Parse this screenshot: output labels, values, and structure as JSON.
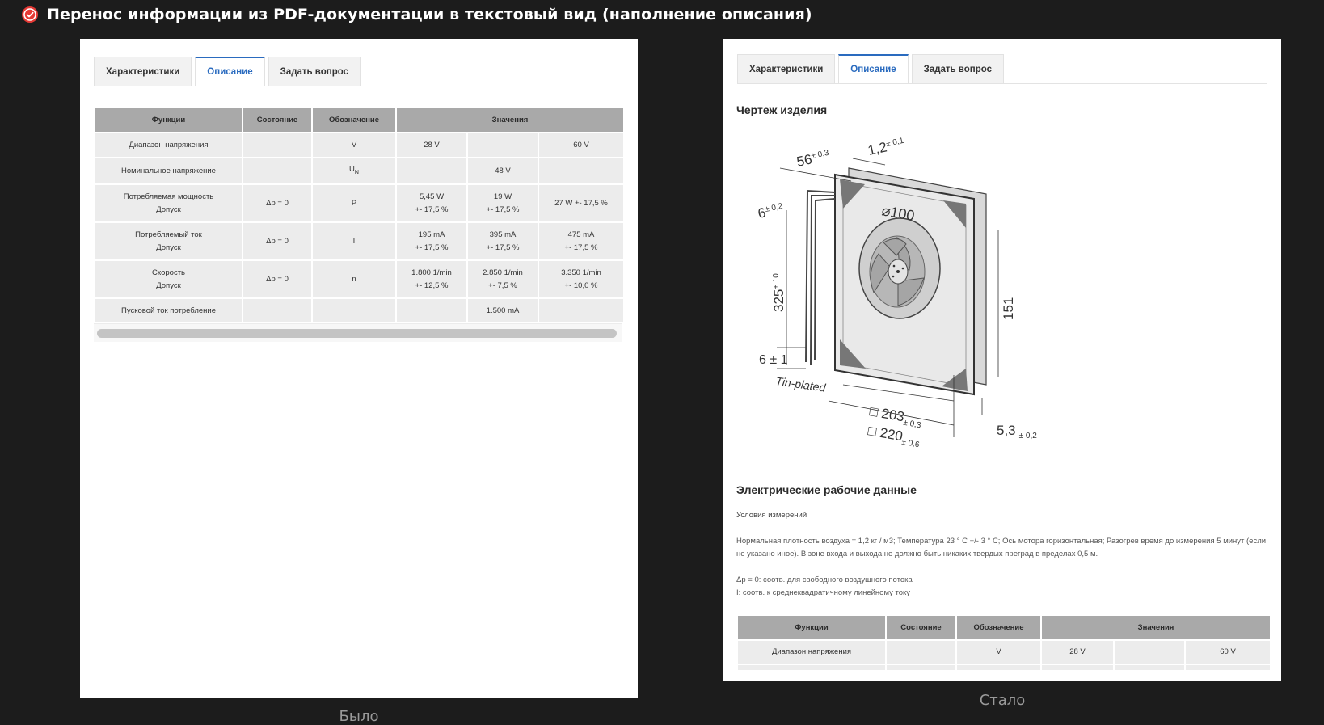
{
  "header": {
    "title": "Перенос информации из PDF-документации в текстовый вид (наполнение описания)",
    "status_icon": "check-circle-icon",
    "accent_color": "#e53935"
  },
  "tabs": [
    "Характеристики",
    "Описание",
    "Задать вопрос"
  ],
  "before": {
    "caption": "Было",
    "active_tab": "Описание",
    "table": {
      "headers": [
        "Функции",
        "Состояние",
        "Обозначение",
        "Значения"
      ],
      "rows": [
        {
          "func": "Диапазон напряжения",
          "state": "",
          "symbol": "V",
          "values": [
            "28 V",
            "",
            "60 V"
          ]
        },
        {
          "func": "Номинальное напряжение",
          "state": "",
          "symbol": "U",
          "symbol_sub": "N",
          "values": [
            "",
            "48 V",
            ""
          ]
        },
        {
          "func": "Потребляемая мощность",
          "func2": "Допуск",
          "state": "Δp = 0",
          "symbol": "P",
          "values": [
            "5,45 W",
            "19 W",
            "27 W +- 17,5 %"
          ],
          "values2": [
            "+- 17,5 %",
            "+- 17,5 %",
            ""
          ]
        },
        {
          "func": "Потребляемый ток",
          "func2": "Допуск",
          "state": "Δp = 0",
          "symbol": "I",
          "values": [
            "195 mA",
            "395 mA",
            "475 mA"
          ],
          "values2": [
            "+- 17,5 %",
            "+- 17,5 %",
            "+- 17,5 %"
          ]
        },
        {
          "func": "Скорость",
          "func2": "Допуск",
          "state": "Δp = 0",
          "symbol": "n",
          "values": [
            "1.800 1/min",
            "2.850 1/min",
            "3.350 1/min"
          ],
          "values2": [
            "+- 12,5 %",
            "+- 7,5 %",
            "+- 10,0 %"
          ]
        },
        {
          "func": "Пусковой ток потребление",
          "state": "",
          "symbol": "",
          "values": [
            "",
            "1.500 mA",
            ""
          ]
        }
      ]
    }
  },
  "after": {
    "caption": "Стало",
    "active_tab": "Описание",
    "drawing_title": "Чертеж изделия",
    "drawing_labels": {
      "d1": "56",
      "d1_tol": "± 0,3",
      "d2": "1,2",
      "d2_tol": "± 0,1",
      "d3": "6",
      "d3_tol": "± 0,2",
      "dia": "⌀100",
      "len": "325",
      "len_tol": "± 10",
      "h": "151",
      "d4": "6 ± 1",
      "tin": "Tin-plated",
      "w1": "□ 203",
      "w1_tol": "± 0,3",
      "w2": "□ 220",
      "w2_tol": "± 0,6",
      "depth": "5,3",
      "depth_tol": "± 0,2"
    },
    "electrical_title": "Электрические рабочие данные",
    "conditions_title": "Условия измерений",
    "conditions_text": "Нормальная плотность воздуха = 1,2 кг / м3; Температура 23 ° C +/- 3 ° C; Ось мотора горизонтальная; Разогрев время до измерения 5 минут (если не указано иное). В зоне входа и выхода не должно быть никаких твердых преград в пределах 0,5 м.",
    "note1": "Δp = 0: соотв. для свободного воздушного потока",
    "note2": "I: соотв. к среднеквадратичному линейному току",
    "table": {
      "headers": [
        "Функции",
        "Состояние",
        "Обозначение",
        "Значения"
      ],
      "row": {
        "func": "Диапазон напряжения",
        "state": "",
        "symbol": "V",
        "values": [
          "28 V",
          "",
          "60 V"
        ]
      }
    }
  }
}
